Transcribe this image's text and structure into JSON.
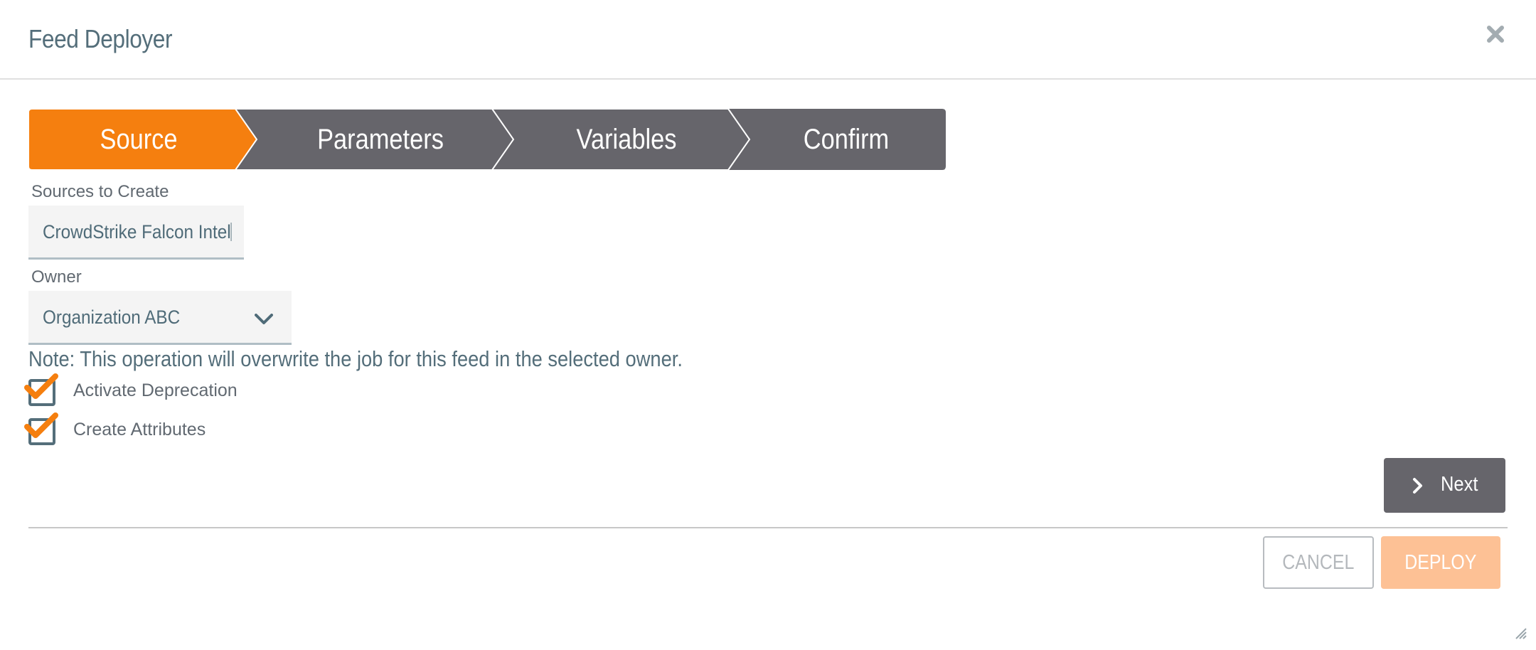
{
  "dialog": {
    "title": "Feed Deployer",
    "close_icon": "close-icon"
  },
  "wizard": {
    "active_index": 0,
    "colors": {
      "active": "#f57f0f",
      "inactive": "#66656b"
    },
    "steps": [
      {
        "label": "Source"
      },
      {
        "label": "Parameters"
      },
      {
        "label": "Variables"
      },
      {
        "label": "Confirm"
      }
    ]
  },
  "form": {
    "sources": {
      "label": "Sources to Create",
      "value": "CrowdStrike Falcon Intel",
      "visible_text": "CrowdStrike Falcon Intel"
    },
    "owner": {
      "label": "Owner",
      "selected": "Organization ABC",
      "icon": "chevron-down-icon"
    },
    "note": "Note: This operation will overwrite the job for this feed in the selected owner.",
    "checkboxes": [
      {
        "label": "Activate Deprecation",
        "checked": true
      },
      {
        "label": "Create Attributes",
        "checked": true
      }
    ]
  },
  "actions": {
    "next_label": "Next",
    "next_icon": "chevron-right-icon",
    "cancel_label": "CANCEL",
    "deploy_label": "DEPLOY"
  },
  "colors": {
    "accent": "#f57f0f",
    "text": "#546e7a",
    "deploy_disabled": "#fdc195"
  }
}
